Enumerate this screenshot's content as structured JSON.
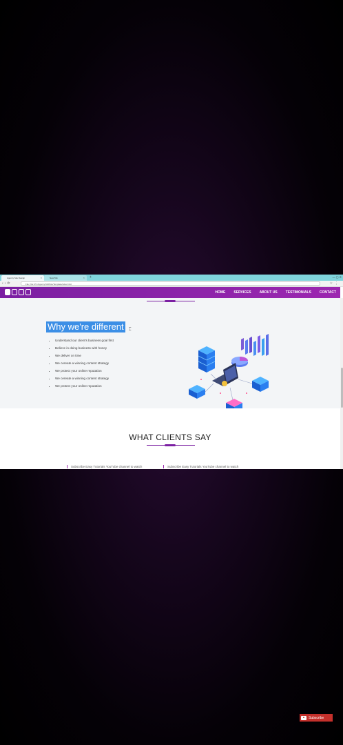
{
  "browser": {
    "tabs": [
      {
        "label": "Agency Site Design"
      },
      {
        "label": "New Tab"
      }
    ],
    "url": "File  | file:///C:/Agency%20Site/Template/index.html"
  },
  "site": {
    "menu": [
      "HOME",
      "SERVICES",
      "ABOUT US",
      "TESTIMONIALS",
      "CONTACT"
    ],
    "section_title": "Why we're different",
    "bullets": [
      "Understand our client's business goal first",
      "Believe in doing business with honey",
      "We deliver on time",
      "We cereate a winning content strategy",
      "We protect your online reputation",
      "We cereate a winning content strategy",
      "We protect your online reputation"
    ],
    "clients_title": "WHAT CLIENTS SAY",
    "testimonials": [
      "Subscribe Easy Tutorials YouTube channel to watch",
      "Subscribe Easy Tutorials YouTube channel to watch"
    ]
  },
  "overlay": {
    "subscribe_label": "Subscribe"
  },
  "colors": {
    "nav_purple": "#8e24aa",
    "highlight_blue": "#3c8fe6",
    "youtube_red": "#c4302b"
  }
}
